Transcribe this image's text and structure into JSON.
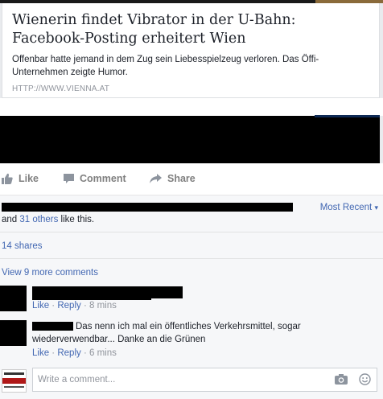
{
  "preview": {
    "title": "Wienerin findet Vibrator in der U-Bahn: Facebook-Posting erheitert Wien",
    "description": "Offenbar hatte jemand in dem Zug sein Liebesspielzeug verloren. Das Öffi-Unternehmen zeigte Humor.",
    "domain": "HTTP://WWW.VIENNA.AT"
  },
  "actions": {
    "like": "Like",
    "comment": "Comment",
    "share": "Share"
  },
  "likes": {
    "text_prefix": "and ",
    "others_link": "31 others",
    "text_suffix": " like this.",
    "sort_label": "Most Recent",
    "sort_caret": "▾"
  },
  "shares": "14 shares",
  "view_more": "View 9 more comments",
  "comments": [
    {
      "like": "Like",
      "reply": "Reply",
      "time": "8 mins",
      "sep": " · "
    },
    {
      "text": "Das nenn ich mal ein öffentliches Verkehrsmittel, sogar wiederverwendbar... Danke an die Grünen",
      "like": "Like",
      "reply": "Reply",
      "time": "6 mins",
      "sep": " · "
    }
  ],
  "composer": {
    "placeholder": "Write a comment...",
    "avatar_icon": "vienna-online-logo",
    "camera_icon": "camera-icon",
    "emoji_icon": "smiley-icon"
  },
  "colors": {
    "link": "#4267b2",
    "muted": "#90949c",
    "action": "#7f7f7f"
  }
}
